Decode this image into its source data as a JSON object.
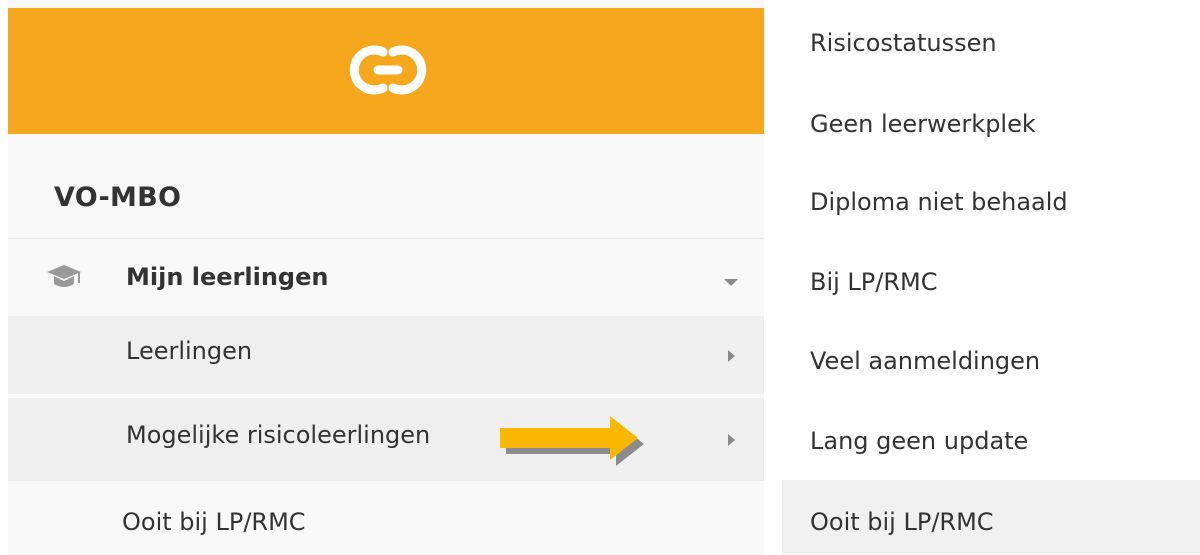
{
  "sidebar": {
    "brand_color": "#f5a71e",
    "logo_icon": "brand-logo-icon",
    "section_title": "VO-MBO",
    "parent": {
      "label": "Mijn leerlingen",
      "icon": "graduation-cap-icon",
      "expanded": true
    },
    "children": [
      {
        "label": "Leerlingen",
        "has_submenu": true
      },
      {
        "label": "Mogelijke risicoleerlingen",
        "has_submenu": true
      },
      {
        "label": "Ooit bij LP/RMC",
        "has_submenu": false
      }
    ]
  },
  "annotation": {
    "arrow_color": "#f9b800"
  },
  "submenu": {
    "items": [
      {
        "label": "Risicostatussen"
      },
      {
        "label": "Geen leerwerkplek"
      },
      {
        "label": "Diploma niet behaald"
      },
      {
        "label": "Bij LP/RMC"
      },
      {
        "label": "Veel aanmeldingen"
      },
      {
        "label": "Lang geen update"
      },
      {
        "label": "Ooit bij LP/RMC",
        "highlighted": true
      }
    ]
  }
}
